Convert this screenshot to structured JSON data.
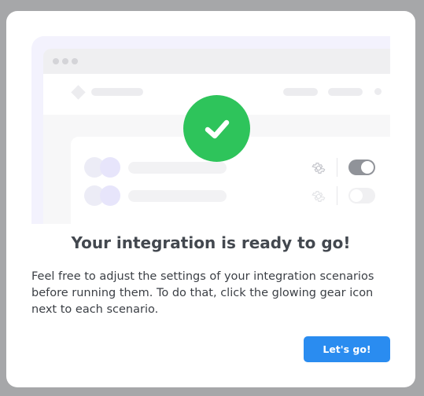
{
  "dialog": {
    "title": "Your integration is ready to go!",
    "description": "Feel free to adjust the settings of your integration scenarios before running them. To do that, click the glowing gear icon next to each scenario.",
    "primary_button_label": "Let's go!"
  },
  "illustration": {
    "scenarios": [
      {
        "toggle": "on"
      },
      {
        "toggle": "off"
      }
    ],
    "icons": [
      "check-icon",
      "gear-icon"
    ]
  },
  "colors": {
    "accent": "#2a8cf0",
    "success": "#2ec45b",
    "title": "#43484f",
    "text": "#3b3f45",
    "backdrop": "#a6a7a9"
  }
}
